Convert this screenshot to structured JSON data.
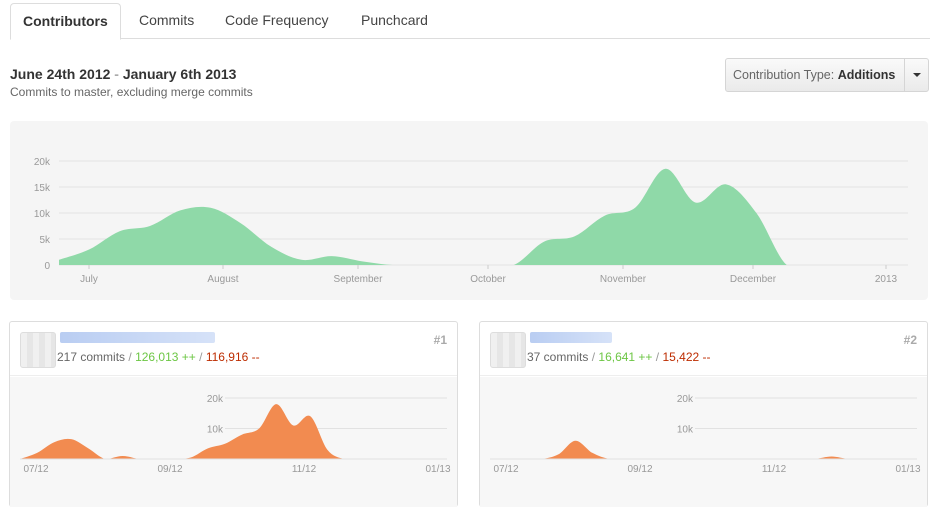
{
  "tabs": [
    {
      "label": "Contributors",
      "active": true
    },
    {
      "label": "Commits"
    },
    {
      "label": "Code Frequency"
    },
    {
      "label": "Punchcard"
    }
  ],
  "header": {
    "date_start": "June 24th 2012",
    "date_separator": "-",
    "date_end": "January 6th 2013",
    "subtitle": "Commits to master, excluding merge commits"
  },
  "contribution_type": {
    "prefix": "Contribution Type:",
    "value": "Additions",
    "caret_icon": "caret-down-icon"
  },
  "colors": {
    "main_area": "#8fd9a8",
    "contributor_area": "#f28b50",
    "additions": "#6cc644",
    "deletions": "#bd2c00"
  },
  "chart_data": [
    {
      "type": "area",
      "title": "",
      "xlabel": "",
      "ylabel": "",
      "x_tick_labels": [
        "July",
        "August",
        "September",
        "October",
        "November",
        "December",
        "2013"
      ],
      "y_tick_labels": [
        "20k",
        "15k",
        "10k",
        "5k",
        "0"
      ],
      "ylim": [
        0,
        20000
      ],
      "grid": true,
      "series": [
        {
          "x": [
            "2012-06-24",
            "2012-07-01",
            "2012-07-08",
            "2012-07-15",
            "2012-07-22",
            "2012-07-29",
            "2012-08-05",
            "2012-08-12",
            "2012-08-19",
            "2012-08-26",
            "2012-09-02",
            "2012-09-09",
            "2012-09-16",
            "2012-09-23",
            "2012-09-30",
            "2012-10-07",
            "2012-10-14",
            "2012-10-21",
            "2012-10-28",
            "2012-11-04",
            "2012-11-11",
            "2012-11-18",
            "2012-11-25",
            "2012-12-02",
            "2012-12-09",
            "2012-12-16",
            "2012-12-23",
            "2012-12-30",
            "2013-01-06"
          ],
          "values": [
            1000,
            3000,
            6500,
            7500,
            10500,
            11000,
            8000,
            3500,
            1000,
            1700,
            700,
            0,
            0,
            0,
            0,
            0,
            4500,
            5500,
            9500,
            11000,
            18500,
            12000,
            15500,
            10000,
            0,
            0,
            0,
            0,
            0
          ]
        }
      ]
    },
    {
      "type": "area",
      "title": "",
      "rank": "#1",
      "x_tick_labels": [
        "07/12",
        "09/12",
        "11/12",
        "01/13"
      ],
      "y_tick_labels": [
        "20k",
        "10k"
      ],
      "ylim": [
        0,
        20000
      ],
      "series": [
        {
          "values": [
            0,
            2000,
            5500,
            6500,
            3500,
            0,
            1000,
            0,
            0,
            0,
            500,
            3500,
            5000,
            8000,
            10000,
            18000,
            11000,
            14000,
            3000,
            0,
            0,
            0,
            0,
            0,
            0,
            0
          ]
        }
      ]
    },
    {
      "type": "area",
      "title": "",
      "rank": "#2",
      "x_tick_labels": [
        "07/12",
        "09/12",
        "11/12",
        "01/13"
      ],
      "y_tick_labels": [
        "20k",
        "10k"
      ],
      "ylim": [
        0,
        20000
      ],
      "series": [
        {
          "values": [
            0,
            0,
            0,
            0,
            1500,
            6000,
            2000,
            0,
            0,
            0,
            0,
            0,
            0,
            0,
            0,
            0,
            0,
            0,
            0,
            0,
            800,
            0,
            0,
            0,
            0,
            0
          ]
        }
      ]
    }
  ],
  "contributors": [
    {
      "rank": "#1",
      "commits": "217 commits",
      "additions": "126,013 ++",
      "deletions": "116,916 --",
      "separator": "/"
    },
    {
      "rank": "#2",
      "commits": "37 commits",
      "additions": "16,641 ++",
      "deletions": "15,422 --",
      "separator": "/"
    }
  ]
}
